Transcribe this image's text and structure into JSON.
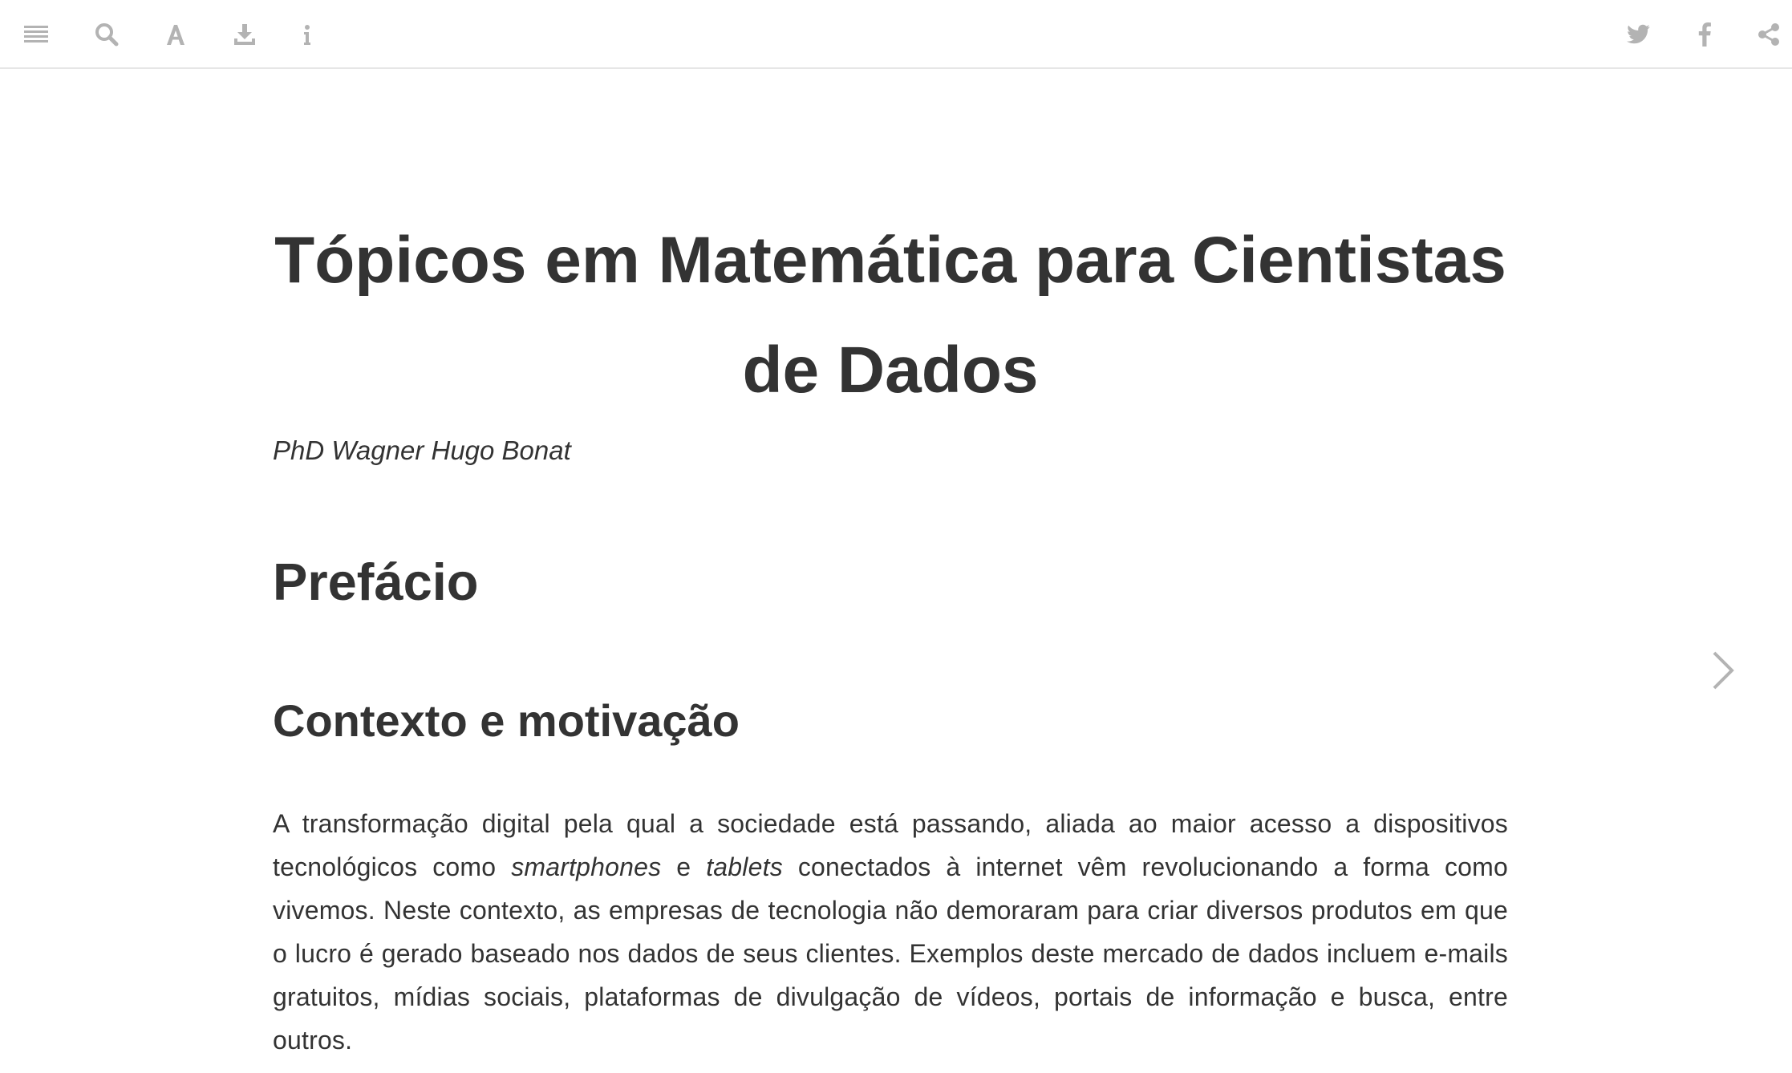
{
  "toolbar": {
    "left_icons": [
      "menu-icon",
      "search-icon",
      "font-settings-icon",
      "download-icon",
      "info-icon"
    ],
    "right_icons": [
      "twitter-icon",
      "facebook-icon",
      "share-icon"
    ],
    "icon_color": "#b3b3b3"
  },
  "document": {
    "title": "Tópicos em Matemática para Cientistas de Dados",
    "author": "PhD Wagner Hugo Bonat",
    "chapter_heading": "Prefácio",
    "section_heading": "Contexto e motivação",
    "paragraph": {
      "part1": "A transformação digital pela qual a sociedade está passando, aliada ao maior acesso a dispositivos tecnológicos como ",
      "em1": "smartphones",
      "part2": " e ",
      "em2": "tablets",
      "part3": " conectados à internet vêm revolucionando a forma como vivemos. Neste contexto, as empresas de tecnologia não demoraram para criar diversos produtos em que o lucro é gerado baseado nos dados de seus clientes. Exemplos deste mercado de dados incluem e-mails gratuitos, mídias sociais, plataformas de divulgação de vídeos, portais de informação e busca, entre outros."
    }
  },
  "navigation": {
    "next_icon": "chevron-right-icon"
  },
  "colors": {
    "text": "#333333",
    "icon": "#b3b3b3",
    "divider": "#e6e6e6"
  }
}
